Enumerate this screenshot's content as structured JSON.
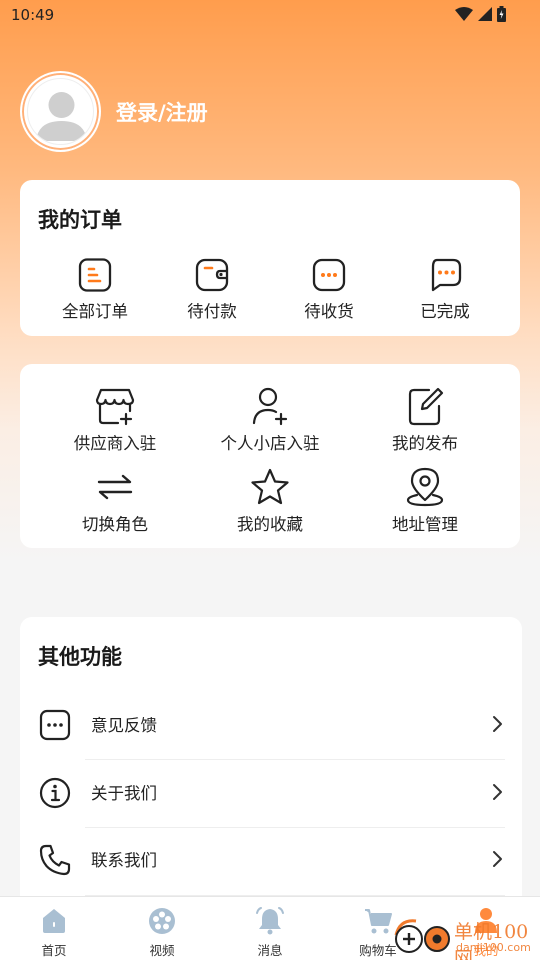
{
  "status_bar": {
    "time": "10:49"
  },
  "profile": {
    "login_label": "登录/注册"
  },
  "orders": {
    "title": "我的订单",
    "items": [
      {
        "label": "全部订单",
        "icon": "list-icon"
      },
      {
        "label": "待付款",
        "icon": "wallet-icon"
      },
      {
        "label": "待收货",
        "icon": "dots-box-icon"
      },
      {
        "label": "已完成",
        "icon": "chat-dots-icon"
      }
    ]
  },
  "tools": {
    "items": [
      {
        "label": "供应商入驻",
        "icon": "store-add-icon"
      },
      {
        "label": "个人小店入驻",
        "icon": "user-add-icon"
      },
      {
        "label": "我的发布",
        "icon": "edit-icon"
      },
      {
        "label": "切换角色",
        "icon": "swap-icon"
      },
      {
        "label": "我的收藏",
        "icon": "star-icon"
      },
      {
        "label": "地址管理",
        "icon": "location-icon"
      }
    ]
  },
  "other": {
    "title": "其他功能",
    "items": [
      {
        "label": "意见反馈",
        "icon": "feedback-icon"
      },
      {
        "label": "关于我们",
        "icon": "info-icon"
      },
      {
        "label": "联系我们",
        "icon": "phone-icon"
      }
    ]
  },
  "tabbar": {
    "items": [
      {
        "label": "首页",
        "icon": "home-icon"
      },
      {
        "label": "视频",
        "icon": "video-reel-icon"
      },
      {
        "label": "消息",
        "icon": "bell-icon"
      },
      {
        "label": "购物车",
        "icon": "cart-icon"
      },
      {
        "label": "我的",
        "icon": "user-icon",
        "active": true
      }
    ]
  },
  "watermark": {
    "text": "单机100网",
    "sub": "danji100.com"
  },
  "colors": {
    "accent": "#ff8a3d",
    "tab_inactive_icon": "#a9bfd2"
  }
}
